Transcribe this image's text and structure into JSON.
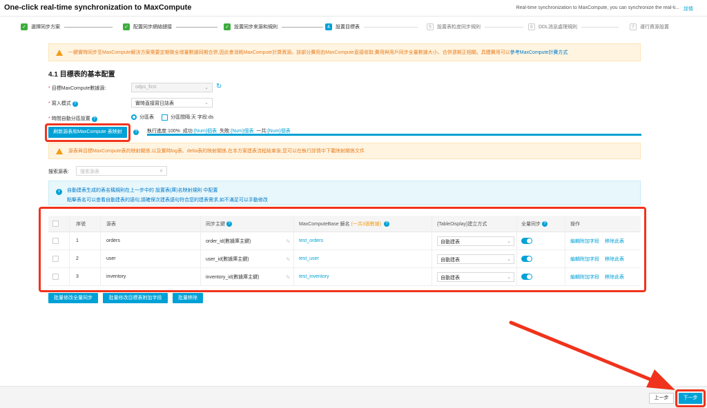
{
  "header": {
    "title": "One-click real-time synchronization to MaxCompute",
    "description": "Real-time synchronization to MaxCompute, you can synchronize the real-ti...",
    "detail_link": "詳情"
  },
  "steps": [
    {
      "label": "選擇同步方案",
      "state": "done",
      "icon": "✓"
    },
    {
      "label": "配置同步網絡鏈接",
      "state": "done",
      "icon": "✓"
    },
    {
      "label": "設置同步來源和規則",
      "state": "done",
      "icon": "✓"
    },
    {
      "label": "設置目標表",
      "state": "active",
      "icon": "4"
    },
    {
      "label": "設置表粒度同步規則",
      "state": "todo",
      "icon": "5"
    },
    {
      "label": "DDL消息處理規則",
      "state": "todo",
      "icon": "6"
    },
    {
      "label": "運行資源設置",
      "state": "todo",
      "icon": "7"
    }
  ],
  "warning_top": {
    "text": "一鍵實時同步至MaxCompute解決方案需要定期做全增量數據同期合併,因此會消耗MaxCompute計算資源。該部分費用由MaxCompute直接收取;費用與用戶同步全量數據大小、合併週期正相關。具體費用可以",
    "link": "參考MaxCompute計費方式"
  },
  "section_title": "4.1 目標表的基本配置",
  "form": {
    "datasource_label": "目標MaxCompute數據源:",
    "datasource_value": "odps_first",
    "write_mode_label": "寫入模式",
    "write_mode_value": "實時直接寫日誌表",
    "partition_label": "時間自動分區設置",
    "partition_option": "分區表",
    "partition_interval": "分區間隔:天   字段:ds"
  },
  "refresh_button": "刷新源表和MaxCompute 表映射",
  "progress": {
    "label": "執行進度:100%",
    "success_label": "成功:",
    "success_value": "{Num}個表",
    "fail_label": "失敗:",
    "fail_value": "{Num}個表",
    "total_label": "一共:",
    "total_value": "{Num}個表",
    "percent": 100
  },
  "warning_mid": "源表與目標MaxCompute表的映射關係,以及實時log表、delta表的映射關係,在本方案建表流程結束後,您可以在執行詳情中下載映射關係文件",
  "search": {
    "label": "搜索源表:",
    "placeholder": "搜索源表"
  },
  "info": {
    "line1": "自動建表生成的表名稱規則在上一步中的 設置表(庫)名映射規則 中配置",
    "line2": "點擊表名可以查看自動建表的語句,請確保次建表語句符合您的建表需求,如不滿足可以手動修改"
  },
  "table": {
    "headers": {
      "index": "序號",
      "source": "源表",
      "pk": "同步主鍵",
      "target": "MaxComputeBase 鏡名",
      "target_count": "(一共3張數據)",
      "create": "{TableDisplay}建立方式",
      "full_sync": "全量同步",
      "actions": "操作"
    },
    "rows": [
      {
        "index": "1",
        "source": "orders",
        "pk": "order_id(數據庫主鍵)",
        "target": "test_orders",
        "create": "自動建表",
        "full_sync": true
      },
      {
        "index": "2",
        "source": "user",
        "pk": "user_id(數據庫主鍵)",
        "target": "test_user",
        "create": "自動建表",
        "full_sync": true
      },
      {
        "index": "3",
        "source": "inventory",
        "pk": "inventory_id(數據庫主鍵)",
        "target": "test_inventory",
        "create": "自動建表",
        "full_sync": true
      }
    ],
    "action_edit": "編輯附加字段",
    "action_remove": "移除此表"
  },
  "bulk_buttons": {
    "full_sync": "批量修改全量同步",
    "extra_field": "批量修改目標表附加字段",
    "remove": "批量移除"
  },
  "footer": {
    "prev": "上一步",
    "next": "下一步"
  },
  "colors": {
    "primary": "#00a1d6",
    "done": "#3dac3d",
    "warning_bg": "#fff4e0",
    "annotation": "#f0331c"
  }
}
